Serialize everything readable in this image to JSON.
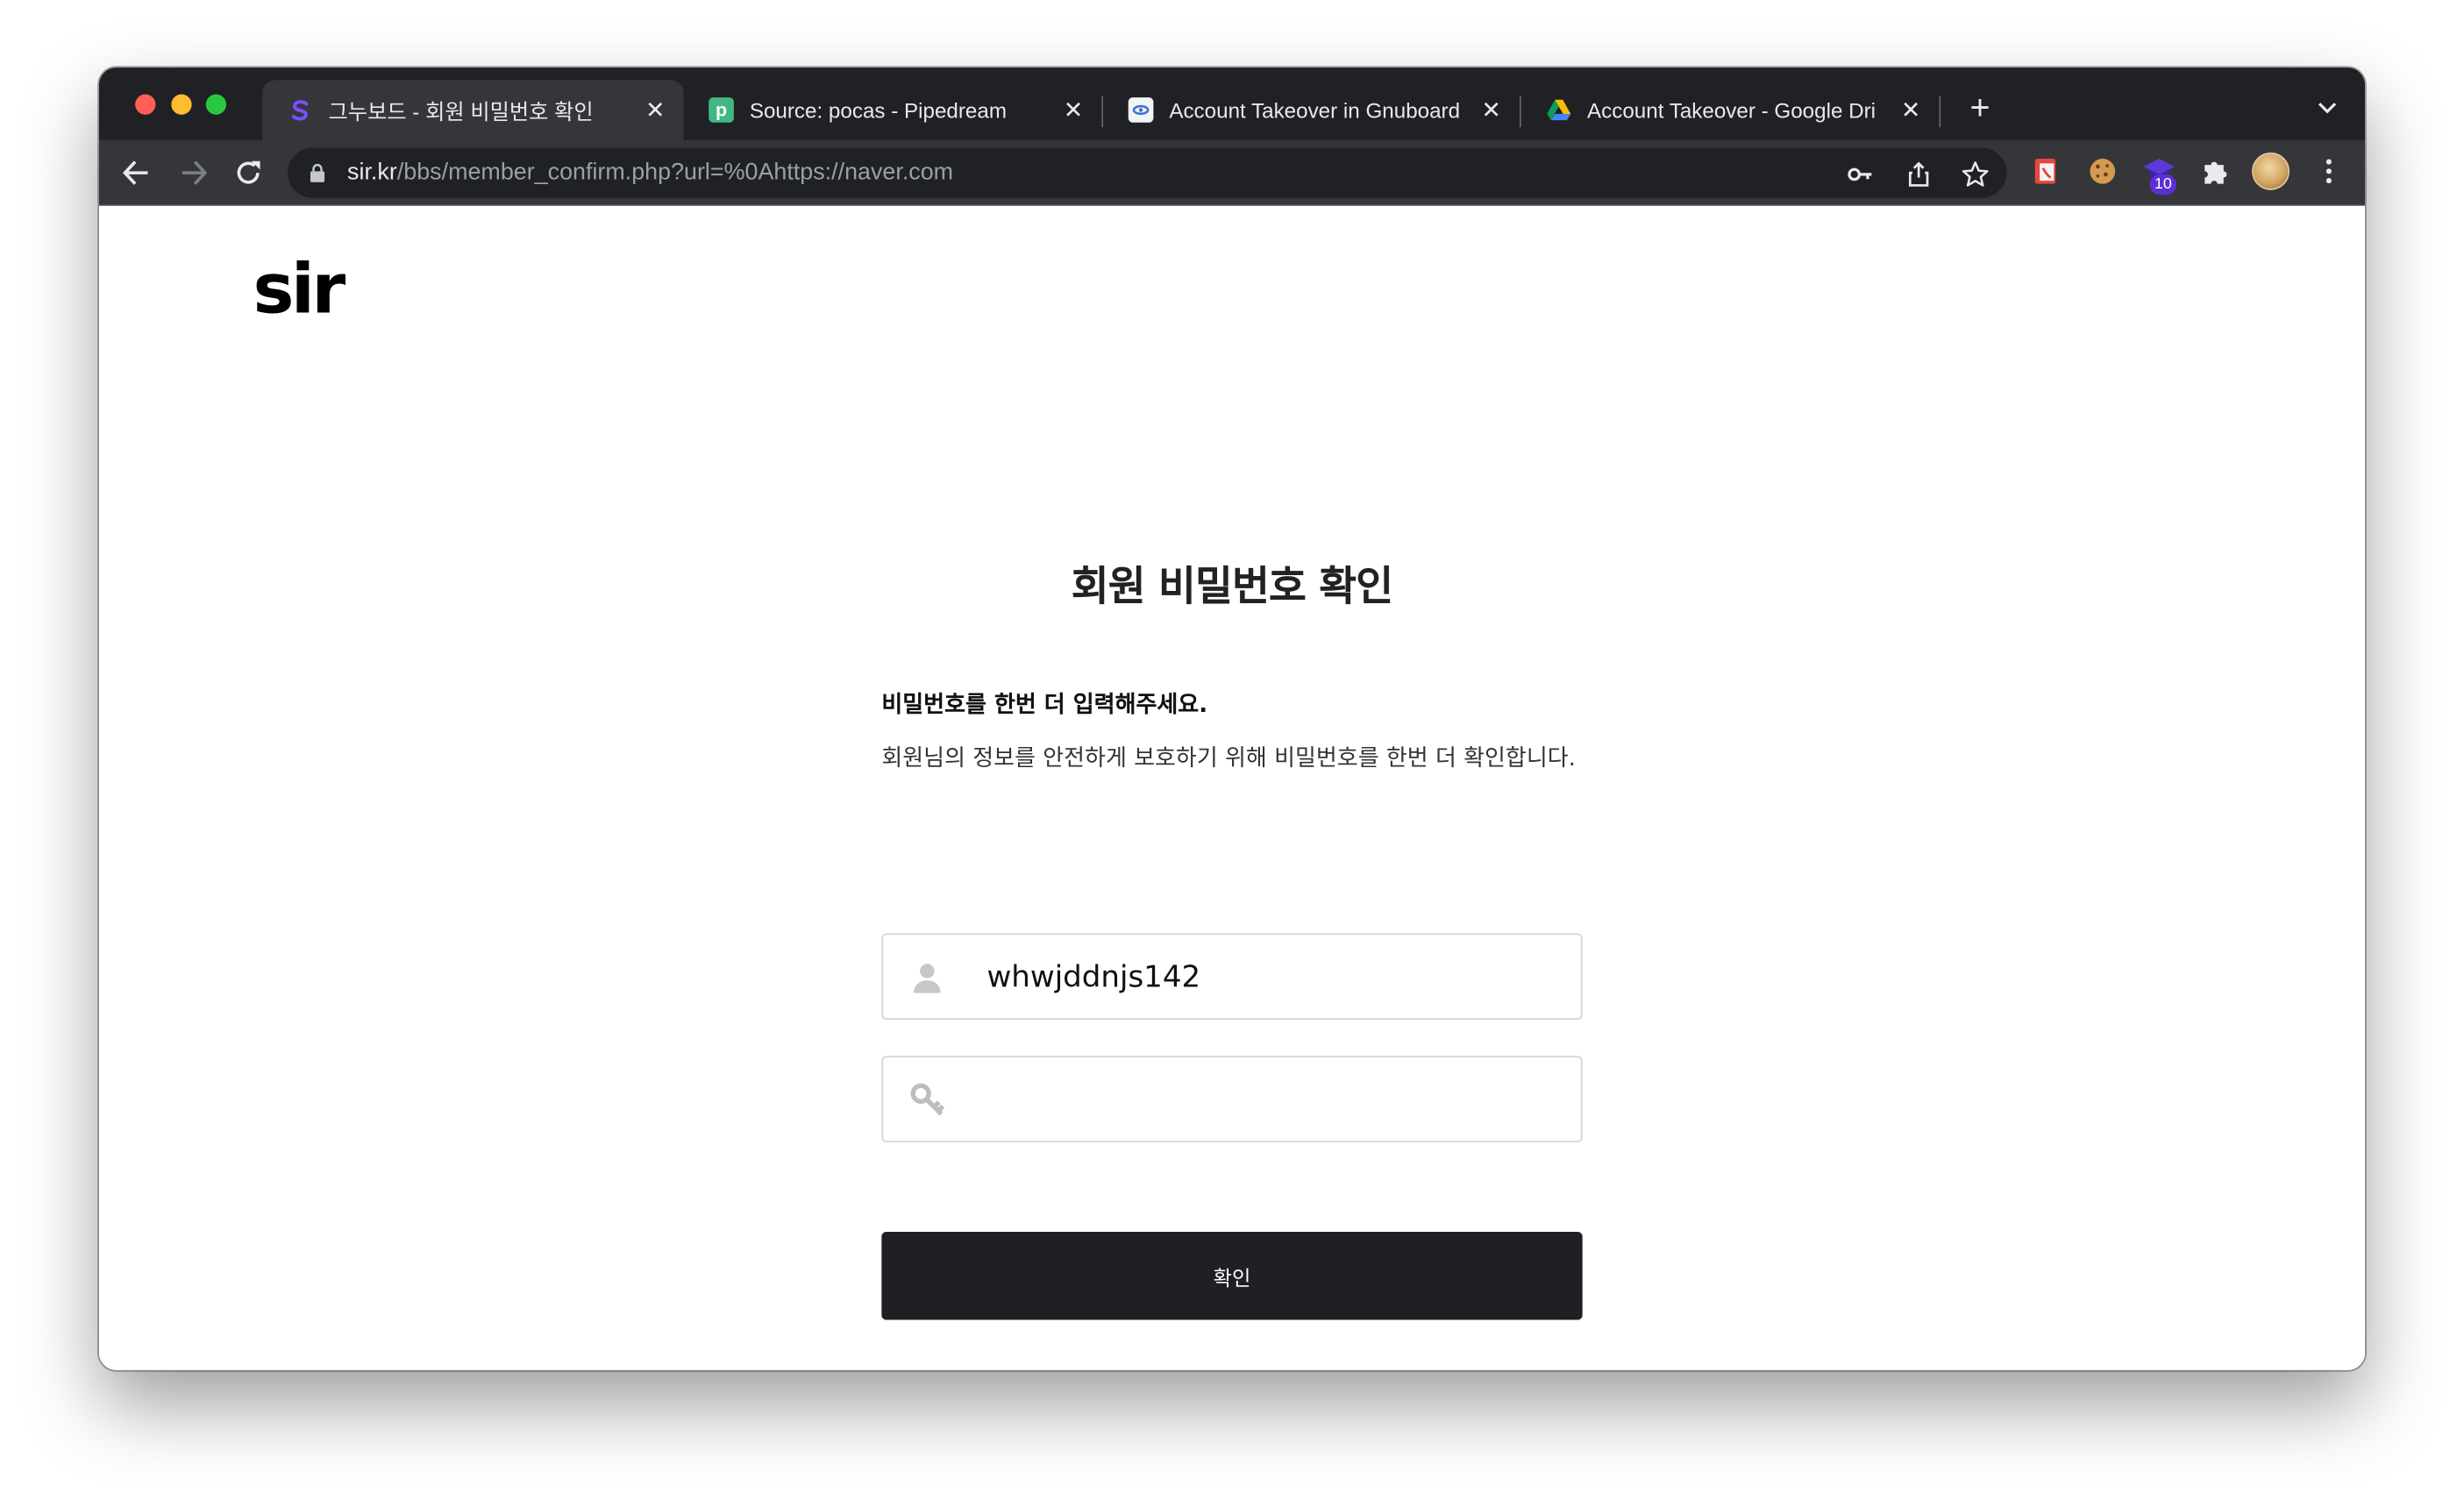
{
  "browser": {
    "tabs": [
      {
        "title": "그누보드 - 회원 비밀번호 확인",
        "favicon": "sir-favicon",
        "active": true
      },
      {
        "title": "Source: pocas - Pipedream",
        "favicon": "pipedream-favicon",
        "favicon_letter": "p",
        "active": false
      },
      {
        "title": "Account Takeover in Gnuboard",
        "favicon": "doc-favicon",
        "active": false
      },
      {
        "title": "Account Takeover - Google Dri",
        "favicon": "google-drive-favicon",
        "active": false
      }
    ],
    "new_tab_label": "+",
    "close_glyph": "✕",
    "address": {
      "host": "sir.kr",
      "path": "/bbs/member_confirm.php?url=%0Ahttps://naver.com"
    },
    "extensions": [
      {
        "name": "pdf-extension-icon"
      },
      {
        "name": "cookie-extension-icon"
      },
      {
        "name": "graduation-cap-extension-icon",
        "badge": "10"
      },
      {
        "name": "puzzle-extensions-icon"
      }
    ],
    "colors": {
      "tabbar": "#202124",
      "toolbar": "#35363a",
      "accent": "#6b3cf0"
    }
  },
  "page": {
    "logo": "sir",
    "heading": "회원 비밀번호 확인",
    "description_strong": "비밀번호를 한번 더 입력해주세요.",
    "description": "회원님의 정보를 안전하게 보호하기 위해 비밀번호를 한번 더 확인합니다.",
    "user_id_value": "whwjddnjs142",
    "password_value": "",
    "confirm_label": "확인",
    "button_color": "#1f2023"
  }
}
